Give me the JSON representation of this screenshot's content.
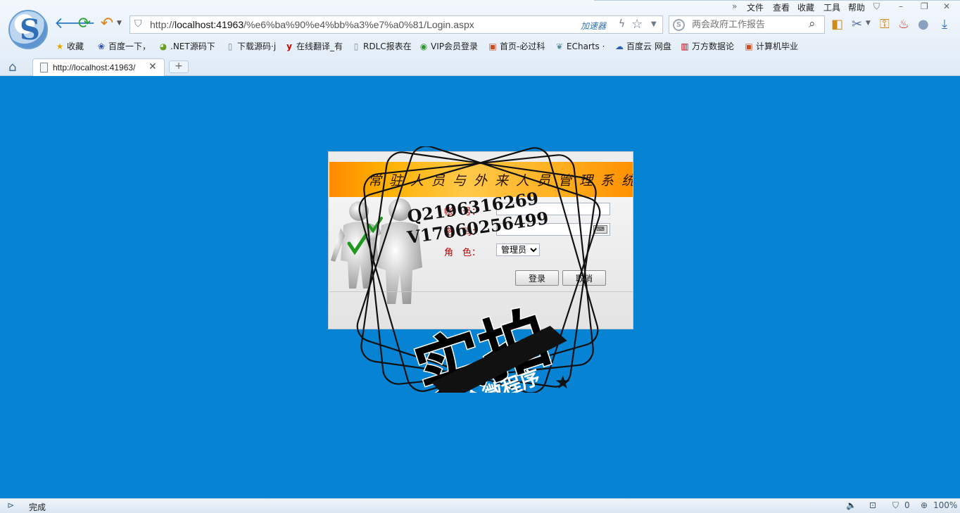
{
  "browser": {
    "menu": [
      "文件",
      "查看",
      "收藏",
      "工具",
      "帮助"
    ],
    "address": {
      "prefix": "http://",
      "host": "localhost:41963",
      "path": "/%e6%ba%90%e4%bb%a3%e7%a0%81/Login.aspx",
      "accelerator": "加速器"
    },
    "search_placeholder": "两会政府工作报告",
    "bookmarks": [
      "收藏",
      "百度一下，",
      ".NET源码下",
      "下载源码·j",
      "在线翻译_有",
      "RDLC报表在",
      "VIP会员登录",
      "首页-必过科",
      "ECharts ·",
      "百度云 网盘",
      "万方数据论",
      "计算机毕业"
    ],
    "tab_title": "http://localhost:41963/",
    "status_text": "完成",
    "status_count": "0",
    "zoom": "100%"
  },
  "login": {
    "system_title": "常驻人员与外来人员管理系统",
    "account_label": "帐　号：",
    "password_label": "密　码：",
    "role_label": "角　色：",
    "role_value": "管理员",
    "login_button": "登录",
    "cancel_button": "取消"
  },
  "watermark": {
    "qq": "Q2196316269",
    "vx": "V17060256499",
    "main": "实拍",
    "ribbon": "全微程序"
  },
  "colors": {
    "page_background": "#0683d2",
    "banner": "#ffb000",
    "label": "#c00000"
  }
}
